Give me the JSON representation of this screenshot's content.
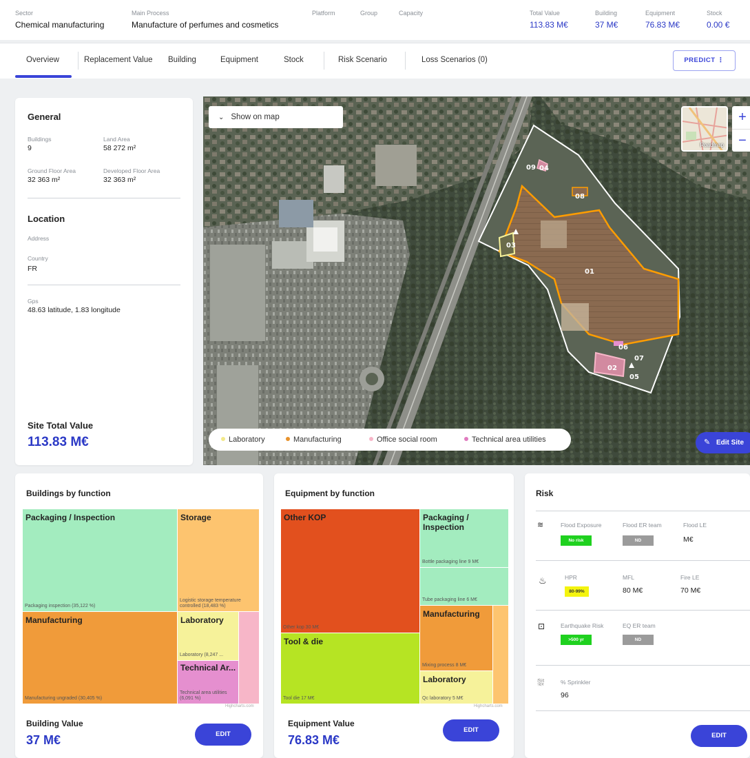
{
  "header": {
    "sector_label": "Sector",
    "sector": "Chemical manufacturing",
    "main_process_label": "Main Process",
    "main_process": "Manufacture of perfumes and cosmetics",
    "platform_label": "Platform",
    "group_label": "Group",
    "capacity_label": "Capacity",
    "total_value_label": "Total Value",
    "total_value": "113.83  M€",
    "building_label": "Building",
    "building_value": "37  M€",
    "equipment_label": "Equipment",
    "equipment_value": "76.83  M€",
    "stock_label": "Stock",
    "stock_value": "0.00  €"
  },
  "tabs": [
    {
      "label": "Overview"
    },
    {
      "label": "Replacement Value"
    },
    {
      "label": "Building"
    },
    {
      "label": "Equipment"
    },
    {
      "label": "Stock"
    },
    {
      "label": "Risk Scenario"
    },
    {
      "label": "Loss Scenarios (0)"
    }
  ],
  "predict_label": "PREDICT",
  "general": {
    "title": "General",
    "buildings_label": "Buildings",
    "buildings": "9",
    "land_area_label": "Land Area",
    "land_area": "58 272 m²",
    "ground_floor_label": "Ground Floor Area",
    "ground_floor": "32 363 m²",
    "developed_floor_label": "Developed Floor Area",
    "developed_floor": "32 363 m²"
  },
  "location": {
    "title": "Location",
    "address_label": "Address",
    "country_label": "Country",
    "country": "FR",
    "gps_label": "Gps",
    "gps": "48.63 latitude,  1.83 longitude"
  },
  "site_total": {
    "label": "Site Total Value",
    "value": "113.83 M€"
  },
  "map": {
    "show_on_map": "Show on map",
    "minimap_label": "Roadmap",
    "zoom_in": "+",
    "zoom_out": "−",
    "edit_site": "Edit Site",
    "building_labels": [
      "01",
      "02",
      "03",
      "04",
      "05",
      "06",
      "07",
      "08",
      "09"
    ],
    "legend": [
      {
        "label": "Laboratory",
        "color": "#f3e98a"
      },
      {
        "label": "Manufacturing",
        "color": "#e8922c"
      },
      {
        "label": "Office social room",
        "color": "#f7b6c8"
      },
      {
        "label": "Technical area utilities",
        "color": "#e07bbf"
      }
    ]
  },
  "buildings_by_function": {
    "title": "Buildings by function",
    "cells": [
      {
        "name": "Packaging / Inspection",
        "sub": "Packaging inspection (35,122 %)",
        "color": "#a3ecbf"
      },
      {
        "name": "Storage",
        "sub": "Logistic storage temperature controlled (18,483 %)",
        "color": "#fdc46f"
      },
      {
        "name": "Manufacturing",
        "sub": "Manufacturing ungraded (30,405 %)",
        "color": "#f09b3a"
      },
      {
        "name": "Laboratory",
        "sub": "Laboratory (8,247 ...",
        "color": "#f6f29a"
      },
      {
        "name": "Technical Ar...",
        "sub": "Technical area utilities (6,091 %)",
        "color": "#e58fcf"
      },
      {
        "name": "",
        "sub": "",
        "color": "#f7b6c8"
      }
    ],
    "credit": "Highcharts.com",
    "value_label": "Building Value",
    "value": "37 M€",
    "edit": "EDIT"
  },
  "equipment_by_function": {
    "title": "Equipment by function",
    "cells": [
      {
        "name": "Other KOP",
        "sub": "Other kop 30 M€",
        "color": "#e2501e"
      },
      {
        "name": "Packaging / Inspection",
        "sub": "Bottle packaging line 9 M€",
        "color": "#a3ecbf"
      },
      {
        "name": "",
        "sub": "Tube packaging line 6 M€",
        "color": "#a3ecbf"
      },
      {
        "name": "Tool & die",
        "sub": "Tool die 17 M€",
        "color": "#b6e423"
      },
      {
        "name": "Manufacturing",
        "sub": "Mixing process 8 M€",
        "color": "#f09b3a"
      },
      {
        "name": "",
        "sub": "",
        "color": "#fdc46f"
      },
      {
        "name": "Laboratory",
        "sub": "Qc laboratory 5 M€",
        "color": "#f6f29a"
      }
    ],
    "credit": "Highcharts.com",
    "value_label": "Equipment Value",
    "value": "76.83 M€",
    "edit": "EDIT"
  },
  "risk": {
    "title": "Risk",
    "flood_exposure_label": "Flood Exposure",
    "flood_exposure": "No risk",
    "flood_er_label": "Flood ER team",
    "flood_er": "ND",
    "flood_le_label": "Flood LE",
    "flood_le": "M€",
    "hpr_label": "HPR",
    "hpr": "80-99%",
    "mfl_label": "MFL",
    "mfl": "80 M€",
    "fire_le_label": "Fire LE",
    "fire_le": "70 M€",
    "eq_label": "Earthquake Risk",
    "eq": ">500 yr",
    "eq_er_label": "EQ ER team",
    "eq_er": "ND",
    "sprinkler_label": "% Sprinkler",
    "sprinkler": "96",
    "edit": "EDIT",
    "colors": {
      "green": "#1fd11f",
      "grey": "#9b9b9b",
      "yellow": "#f4f40f"
    }
  }
}
